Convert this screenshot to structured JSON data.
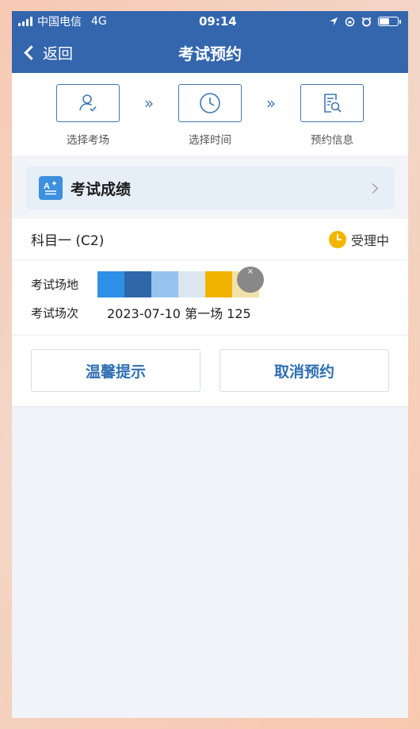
{
  "status_bar": {
    "carrier": "中国电信",
    "network": "4G",
    "time": "09:14"
  },
  "nav": {
    "back_label": "返回",
    "title": "考试预约"
  },
  "steps": [
    {
      "label": "选择考场",
      "icon": "person-check-icon"
    },
    {
      "label": "选择时间",
      "icon": "clock-icon"
    },
    {
      "label": "预约信息",
      "icon": "document-search-icon"
    }
  ],
  "score_entry": {
    "label": "考试成绩",
    "icon": "score-icon"
  },
  "exam": {
    "subject": "科目一 (C2)",
    "status": "受理中",
    "venue_label": "考试场地",
    "session_label": "考试场次",
    "session_value": "2023-07-10 第一场 125",
    "venue_redaction_colors": [
      "#2e8fe6",
      "#2e68a8",
      "#96c3ee",
      "#dbe6ef",
      "#f2b200",
      "#f1e2ab"
    ]
  },
  "actions": {
    "tips_button": "温馨提示",
    "cancel_button": "取消预约"
  },
  "colors": {
    "primary": "#3366ad",
    "accent_blue": "#2f6fb3",
    "status_yellow": "#f2b500"
  }
}
